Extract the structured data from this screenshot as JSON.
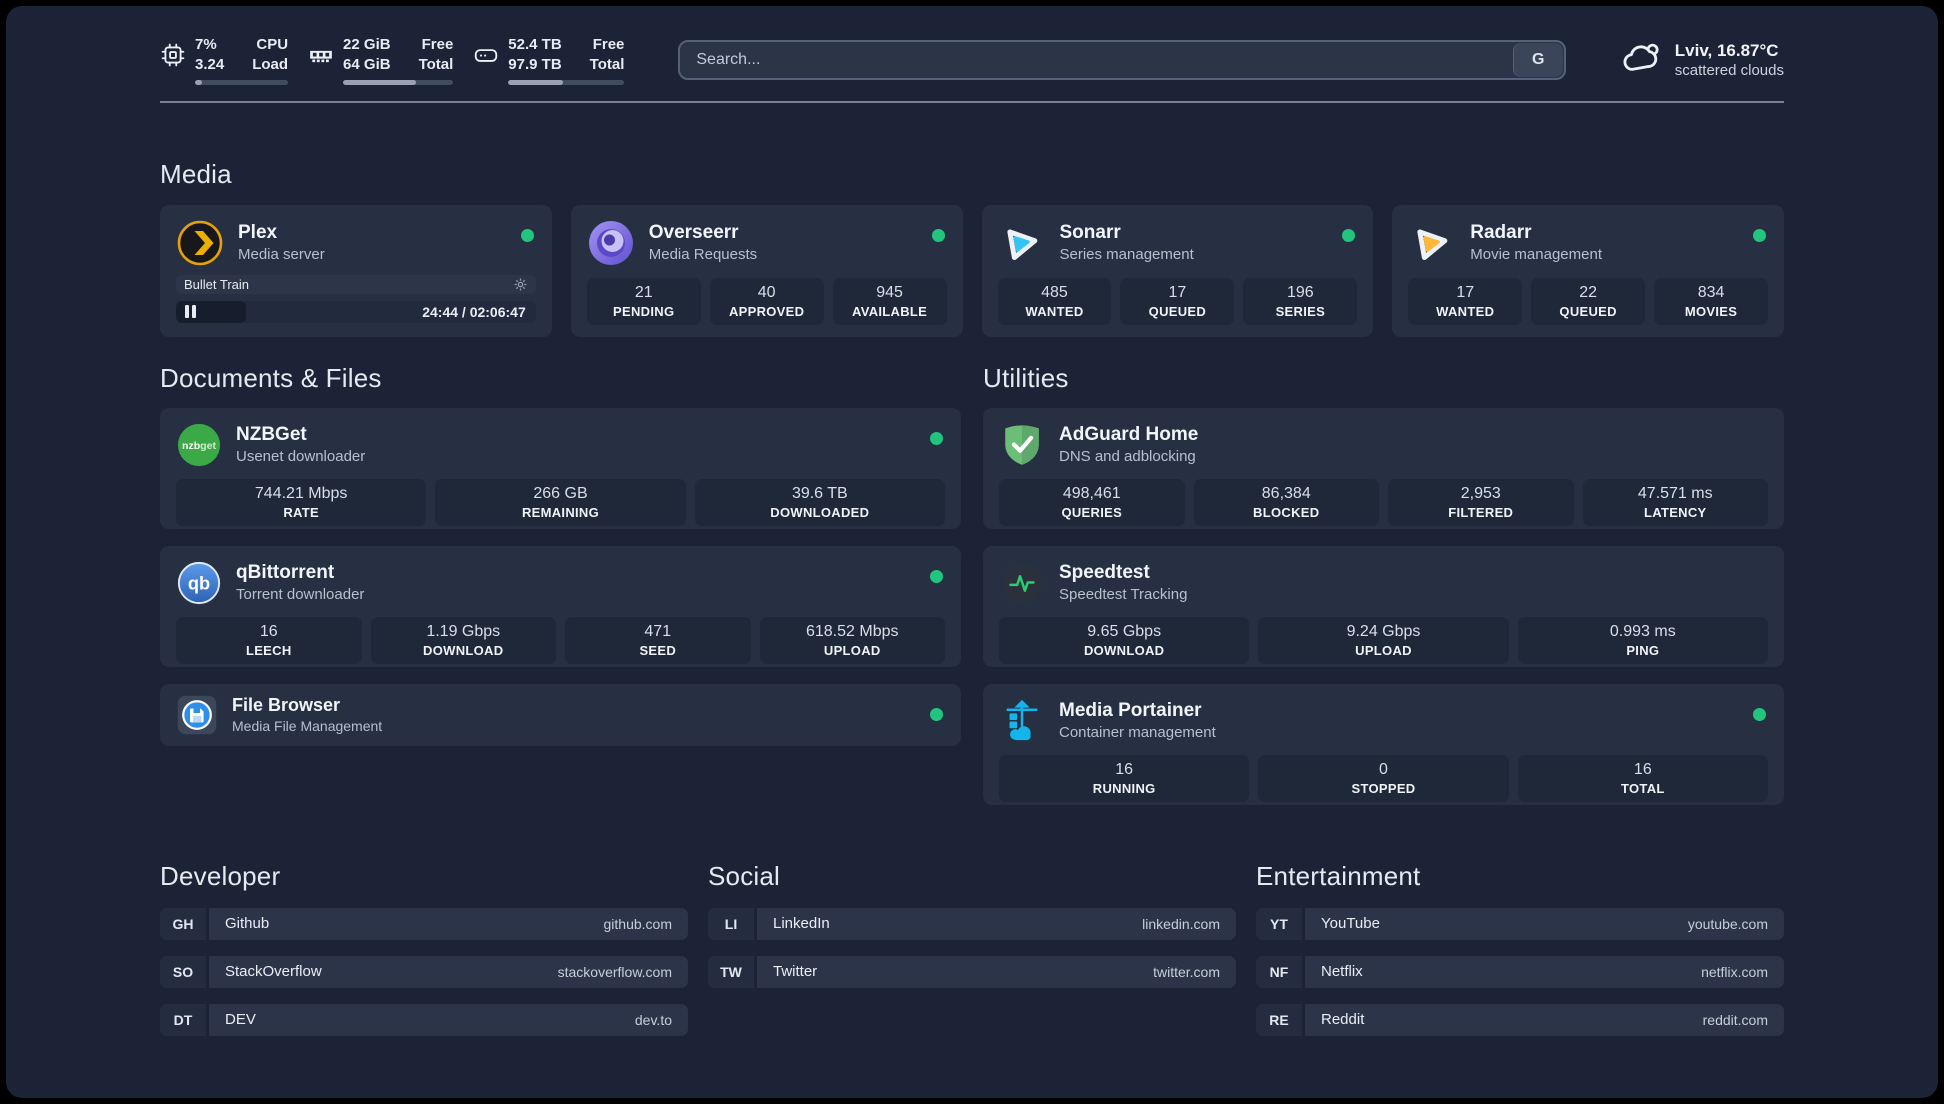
{
  "header": {
    "cpu": {
      "icon": "cpu-chip",
      "value_top": "7%",
      "label_top": "CPU",
      "value_bottom": "3.24",
      "label_bottom": "Load",
      "progress": 8
    },
    "memory": {
      "icon": "ram-stick",
      "value_top": "22 GiB",
      "label_top": "Free",
      "value_bottom": "64 GiB",
      "label_bottom": "Total",
      "progress": 66
    },
    "disk": {
      "icon": "hard-drive",
      "value_top": "52.4 TB",
      "label_top": "Free",
      "value_bottom": "97.9 TB",
      "label_bottom": "Total",
      "progress": 47
    },
    "search": {
      "placeholder": "Search...",
      "engine": "G"
    },
    "weather": {
      "location": "Lviv, 16.87°C",
      "condition": "scattered clouds"
    }
  },
  "sections": {
    "media": {
      "title": "Media",
      "apps": {
        "plex": {
          "name": "Plex",
          "description": "Media server",
          "online": true,
          "now_playing": "Bullet Train",
          "time": "24:44 / 02:06:47",
          "progress": 19.5
        },
        "overseerr": {
          "name": "Overseerr",
          "description": "Media Requests",
          "online": true,
          "stats": [
            {
              "value": "21",
              "label": "PENDING"
            },
            {
              "value": "40",
              "label": "APPROVED"
            },
            {
              "value": "945",
              "label": "AVAILABLE"
            }
          ]
        },
        "sonarr": {
          "name": "Sonarr",
          "description": "Series management",
          "online": true,
          "stats": [
            {
              "value": "485",
              "label": "WANTED"
            },
            {
              "value": "17",
              "label": "QUEUED"
            },
            {
              "value": "196",
              "label": "SERIES"
            }
          ]
        },
        "radarr": {
          "name": "Radarr",
          "description": "Movie management",
          "online": true,
          "stats": [
            {
              "value": "17",
              "label": "WANTED"
            },
            {
              "value": "22",
              "label": "QUEUED"
            },
            {
              "value": "834",
              "label": "MOVIES"
            }
          ]
        }
      }
    },
    "documents": {
      "title": "Documents & Files",
      "apps": {
        "nzbget": {
          "name": "NZBGet",
          "description": "Usenet downloader",
          "online": true,
          "stats": [
            {
              "value": "744.21 Mbps",
              "label": "RATE"
            },
            {
              "value": "266 GB",
              "label": "REMAINING"
            },
            {
              "value": "39.6 TB",
              "label": "DOWNLOADED"
            }
          ]
        },
        "qbittorrent": {
          "name": "qBittorrent",
          "description": "Torrent downloader",
          "online": true,
          "stats": [
            {
              "value": "16",
              "label": "LEECH"
            },
            {
              "value": "1.19 Gbps",
              "label": "DOWNLOAD"
            },
            {
              "value": "471",
              "label": "SEED"
            },
            {
              "value": "618.52 Mbps",
              "label": "UPLOAD"
            }
          ]
        },
        "filebrowser": {
          "name": "File Browser",
          "description": "Media File Management",
          "online": true
        }
      }
    },
    "utilities": {
      "title": "Utilities",
      "apps": {
        "adguard": {
          "name": "AdGuard Home",
          "description": "DNS and adblocking",
          "stats": [
            {
              "value": "498,461",
              "label": "QUERIES"
            },
            {
              "value": "86,384",
              "label": "BLOCKED"
            },
            {
              "value": "2,953",
              "label": "FILTERED"
            },
            {
              "value": "47.571 ms",
              "label": "LATENCY"
            }
          ]
        },
        "speedtest": {
          "name": "Speedtest",
          "description": "Speedtest Tracking",
          "stats": [
            {
              "value": "9.65 Gbps",
              "label": "DOWNLOAD"
            },
            {
              "value": "9.24 Gbps",
              "label": "UPLOAD"
            },
            {
              "value": "0.993 ms",
              "label": "PING"
            }
          ]
        },
        "portainer": {
          "name": "Media Portainer",
          "description": "Container management",
          "online": true,
          "stats": [
            {
              "value": "16",
              "label": "RUNNING"
            },
            {
              "value": "0",
              "label": "STOPPED"
            },
            {
              "value": "16",
              "label": "TOTAL"
            }
          ]
        }
      }
    }
  },
  "links": {
    "developer": {
      "title": "Developer",
      "items": [
        {
          "tag": "GH",
          "name": "Github",
          "url": "github.com"
        },
        {
          "tag": "SO",
          "name": "StackOverflow",
          "url": "stackoverflow.com"
        },
        {
          "tag": "DT",
          "name": "DEV",
          "url": "dev.to"
        }
      ]
    },
    "social": {
      "title": "Social",
      "items": [
        {
          "tag": "LI",
          "name": "LinkedIn",
          "url": "linkedin.com"
        },
        {
          "tag": "TW",
          "name": "Twitter",
          "url": "twitter.com"
        }
      ]
    },
    "entertainment": {
      "title": "Entertainment",
      "items": [
        {
          "tag": "YT",
          "name": "YouTube",
          "url": "youtube.com"
        },
        {
          "tag": "NF",
          "name": "Netflix",
          "url": "netflix.com"
        },
        {
          "tag": "RE",
          "name": "Reddit",
          "url": "reddit.com"
        }
      ]
    }
  },
  "colors": {
    "background": "#1c2336",
    "card": "#272f43",
    "stat_tile": "#1f2839",
    "status_online": "#22c57e",
    "plex_accent": "#e5a00d",
    "sonarr_accent": "#35c5f4",
    "radarr_accent": "#ffc230",
    "overseerr_accent": "#7b6ce0",
    "nzbget_accent": "#3aa946",
    "qbittorrent_accent": "#3d7dd8",
    "adguard_accent": "#68bc71",
    "speedtest_accent": "#2ecc71",
    "portainer_accent": "#13b5ea"
  }
}
